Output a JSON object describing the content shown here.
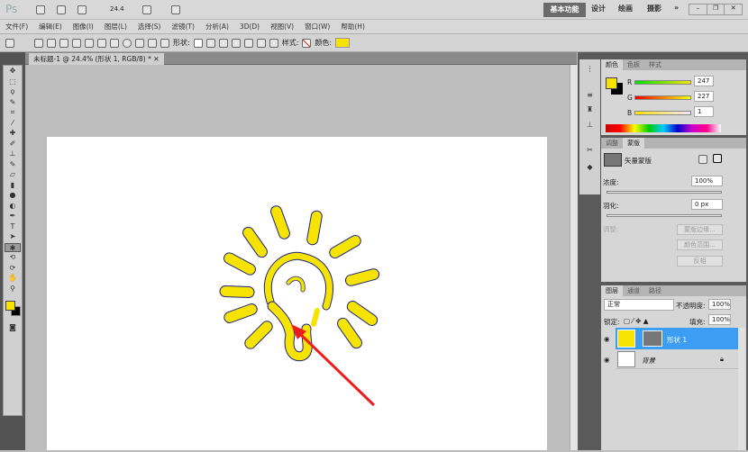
{
  "app": {
    "logo": "Ps",
    "zoom": "24.4",
    "icons": [
      "bridge-icon",
      "mini-bridge-icon",
      "view-extras-icon",
      "arrange-documents-icon",
      "screen-mode-icon"
    ]
  },
  "workspaces": {
    "active": "基本功能",
    "items": [
      "设计",
      "绘画",
      "摄影"
    ],
    "more": "»"
  },
  "window_controls": {
    "minimize": "–",
    "restore": "❐",
    "close": "✕"
  },
  "menu": [
    "文件(F)",
    "编辑(E)",
    "图像(I)",
    "图层(L)",
    "选择(S)",
    "滤镜(T)",
    "分析(A)",
    "3D(D)",
    "视图(V)",
    "窗口(W)",
    "帮助(H)"
  ],
  "options": {
    "shape_label": "形状:",
    "style_label": "样式:",
    "color_label": "颜色:",
    "color": "#f7e301"
  },
  "document": {
    "tab_title": "未标题-1 @ 24.4% (形状 1, RGB/8) *",
    "close": "✕"
  },
  "color_panel": {
    "tabs": [
      "颜色",
      "色板",
      "样式"
    ],
    "r_label": "R",
    "g_label": "G",
    "b_label": "B",
    "r": "247",
    "g": "227",
    "b": "1",
    "foreground": "#f7e301",
    "background": "#000000"
  },
  "masks_panel": {
    "tabs": [
      "调整",
      "蒙版"
    ],
    "mask_type": "矢量蒙版",
    "density_label": "浓度:",
    "density": "100%",
    "feather_label": "羽化:",
    "feather": "0 px",
    "refine_label": "调整:",
    "mask_edge": "蒙版边缘...",
    "color_range": "颜色范围...",
    "invert": "反相"
  },
  "layers_panel": {
    "tabs": [
      "图层",
      "通道",
      "路径"
    ],
    "blend_mode": "正常",
    "opacity_label": "不透明度:",
    "opacity": "100%",
    "lock_label": "锁定:",
    "fill_label": "填充:",
    "fill": "100%",
    "layers": [
      {
        "name": "形状 1",
        "selected": true
      },
      {
        "name": "背景",
        "selected": false
      }
    ]
  },
  "colors": {
    "accent_selected": "#3c9ef2",
    "shape_fill": "#f7e301",
    "arrow": "#ee1c1c"
  }
}
